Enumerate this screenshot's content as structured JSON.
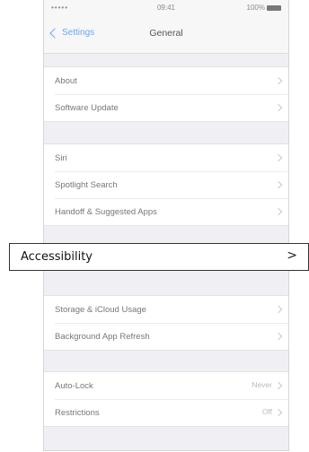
{
  "status_bar": {
    "signal": "••••• ",
    "time": "09:41",
    "battery": "100%"
  },
  "nav": {
    "back_label": "Settings",
    "title": "General"
  },
  "groups": [
    {
      "items": [
        {
          "label": "About"
        },
        {
          "label": "Software Update"
        }
      ]
    },
    {
      "items": [
        {
          "label": "Siri"
        },
        {
          "label": "Spotlight Search"
        },
        {
          "label": "Handoff & Suggested Apps"
        }
      ]
    },
    {
      "items": [
        {
          "label": "Storage & iCloud Usage"
        },
        {
          "label": "Background App Refresh"
        }
      ]
    },
    {
      "items": [
        {
          "label": "Auto-Lock",
          "detail": "Never"
        },
        {
          "label": "Restrictions",
          "detail": "Off"
        }
      ]
    }
  ],
  "callout": {
    "label": "Accessibility",
    "chevron": ">"
  },
  "colors": {
    "accent": "#6aa6ef",
    "background": "#efeff4",
    "row_text": "#777777"
  }
}
